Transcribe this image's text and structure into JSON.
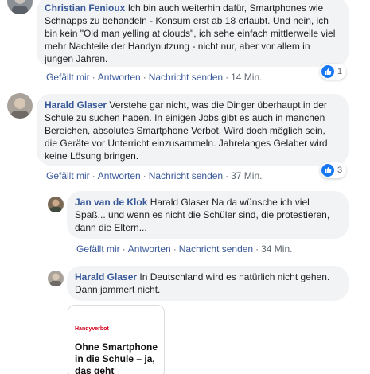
{
  "comments": [
    {
      "author": "Christian Fenioux",
      "text": "Ich bin auch weiterhin dafür, Smartphones wie Schnapps zu behandeln - Konsum erst ab 18 erlaubt. Und nein, ich bin kein \"Old man yelling at clouds\", ich sehe einfach mittlerweile viel mehr Nachteile der Handynutzung - nicht nur, aber vor allem in jungen Jahren.",
      "like": "Gefällt mir",
      "reply": "Antworten",
      "message": "Nachricht senden",
      "time": "14 Min.",
      "reactions": "1"
    },
    {
      "author": "Harald Glaser",
      "text": "Verstehe gar nicht, was die Dinger überhaupt in der Schule zu suchen haben. In einigen Jobs gibt es auch in manchen Bereichen, absolutes Smartphone Verbot. Wird doch möglich sein, die Geräte vor Unterricht einzusammeln. Jahrelanges Gelaber wird keine Lösung bringen.",
      "like": "Gefällt mir",
      "reply": "Antworten",
      "message": "Nachricht senden",
      "time": "37 Min.",
      "reactions": "3"
    },
    {
      "author": "Jan van de Klok",
      "text": "Harald Glaser Na da wünsche ich viel Spaß... und wenn es nicht die Schüler sind, die protestieren, dann die Eltern...",
      "like": "Gefällt mir",
      "reply": "Antworten",
      "message": "Nachricht senden",
      "time": "34 Min."
    },
    {
      "author": "Harald Glaser",
      "text": "In Deutschland wird es natürlich nicht gehen. Dann jammert nicht."
    }
  ],
  "link_preview": {
    "kicker": "Handyverbot",
    "title": "Ohne Smartphone in die Schule – ja, das geht"
  },
  "colors": {
    "author": "#385898",
    "bubble": "#f2f3f5",
    "meta": "#606770",
    "like_blue": "#1877f2"
  }
}
